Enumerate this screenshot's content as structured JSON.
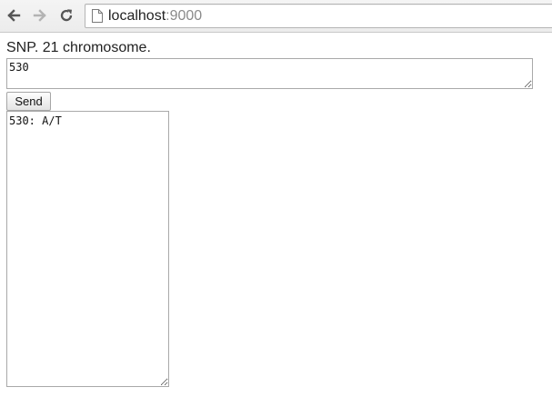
{
  "browser": {
    "url_host": "localhost",
    "url_port": ":9000",
    "icons": {
      "back": "arrow-left-icon",
      "forward": "arrow-right-icon",
      "reload": "reload-icon",
      "page": "page-icon"
    }
  },
  "page": {
    "heading": "SNP. 21 chromosome.",
    "input": {
      "value": "530"
    },
    "send_label": "Send",
    "output": {
      "value": "530: A/T"
    }
  },
  "colors": {
    "toolbar_bg": "#ececec",
    "page_bg": "#ffffff",
    "port_text": "#8a8a8a"
  }
}
